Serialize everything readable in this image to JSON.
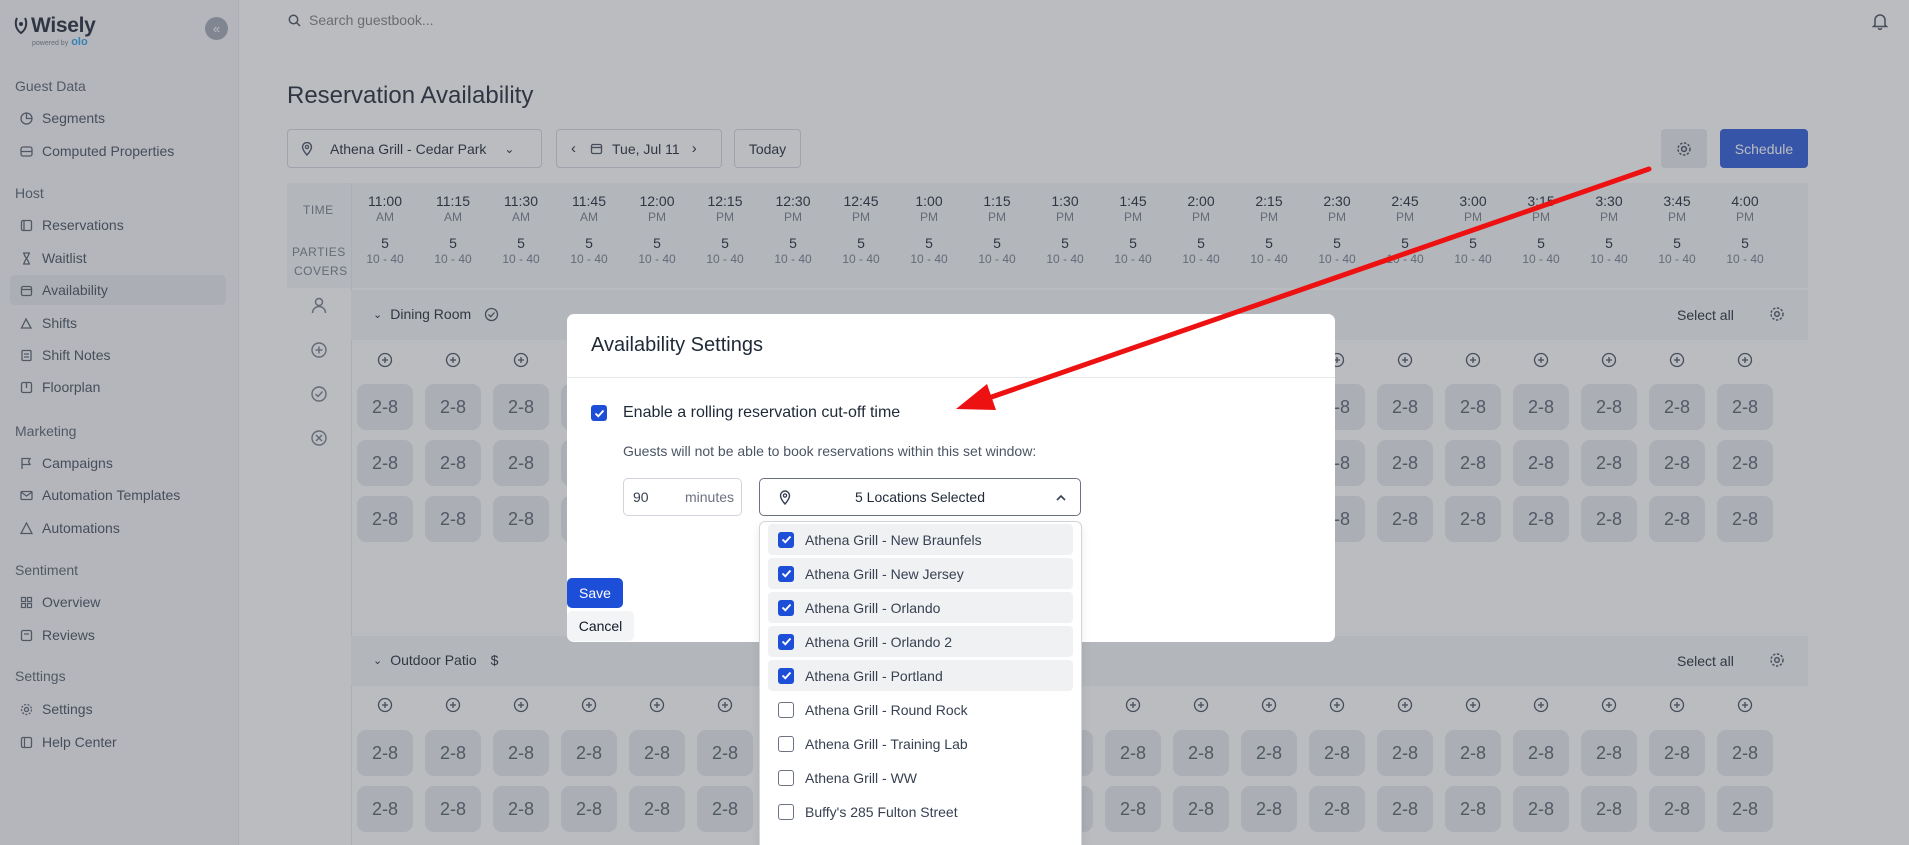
{
  "app": {
    "brand": "Wisely",
    "brand_sub": "powered by",
    "brand_partner": "olo"
  },
  "sidebar": {
    "sections": [
      {
        "title": "Guest Data",
        "items": [
          {
            "label": "Segments",
            "icon": "segments-icon"
          },
          {
            "label": "Computed Properties",
            "icon": "database-icon"
          }
        ]
      },
      {
        "title": "Host",
        "items": [
          {
            "label": "Reservations",
            "icon": "book-icon"
          },
          {
            "label": "Waitlist",
            "icon": "hourglass-icon"
          },
          {
            "label": "Availability",
            "icon": "calendar-icon"
          },
          {
            "label": "Shifts",
            "icon": "shifts-icon"
          },
          {
            "label": "Shift Notes",
            "icon": "notes-icon"
          },
          {
            "label": "Floorplan",
            "icon": "floorplan-icon"
          }
        ]
      },
      {
        "title": "Marketing",
        "items": [
          {
            "label": "Campaigns",
            "icon": "flag-icon"
          },
          {
            "label": "Automation Templates",
            "icon": "mail-icon"
          },
          {
            "label": "Automations",
            "icon": "automation-icon"
          }
        ]
      },
      {
        "title": "Sentiment",
        "items": [
          {
            "label": "Overview",
            "icon": "grid-icon"
          },
          {
            "label": "Reviews",
            "icon": "reviews-icon"
          }
        ]
      },
      {
        "title": "Settings",
        "items": [
          {
            "label": "Settings",
            "icon": "gear-icon"
          },
          {
            "label": "Help Center",
            "icon": "help-icon"
          }
        ]
      }
    ],
    "active": "Availability"
  },
  "topbar": {
    "search_placeholder": "Search guestbook..."
  },
  "page": {
    "title": "Reservation Availability",
    "location": "Athena Grill - Cedar Park",
    "date": "Tue, Jul 11",
    "today_label": "Today",
    "schedule_label": "Schedule"
  },
  "grid": {
    "time_label": "TIME",
    "parties_label": "PARTIES",
    "covers_label": "COVERS",
    "times": [
      {
        "t": "11:00",
        "ap": "AM"
      },
      {
        "t": "11:15",
        "ap": "AM"
      },
      {
        "t": "11:30",
        "ap": "AM"
      },
      {
        "t": "11:45",
        "ap": "AM"
      },
      {
        "t": "12:00",
        "ap": "PM"
      },
      {
        "t": "12:15",
        "ap": "PM"
      },
      {
        "t": "12:30",
        "ap": "PM"
      },
      {
        "t": "12:45",
        "ap": "PM"
      },
      {
        "t": "1:00",
        "ap": "PM"
      },
      {
        "t": "1:15",
        "ap": "PM"
      },
      {
        "t": "1:30",
        "ap": "PM"
      },
      {
        "t": "1:45",
        "ap": "PM"
      },
      {
        "t": "2:00",
        "ap": "PM"
      },
      {
        "t": "2:15",
        "ap": "PM"
      },
      {
        "t": "2:30",
        "ap": "PM"
      },
      {
        "t": "2:45",
        "ap": "PM"
      },
      {
        "t": "3:00",
        "ap": "PM"
      },
      {
        "t": "3:15",
        "ap": "PM"
      },
      {
        "t": "3:30",
        "ap": "PM"
      },
      {
        "t": "3:45",
        "ap": "PM"
      },
      {
        "t": "4:00",
        "ap": "PM"
      }
    ],
    "parties": "5",
    "covers": "10 - 40",
    "slot_label": "2-8",
    "rooms": [
      {
        "name": "Dining Room",
        "select_all": "Select all"
      },
      {
        "name": "Outdoor Patio",
        "select_all": "Select all"
      }
    ]
  },
  "modal": {
    "title": "Availability Settings",
    "enable_label": "Enable a rolling reservation cut-off time",
    "enabled": true,
    "help_text": "Guests will not be able to book reservations within this set window:",
    "minutes_value": "90",
    "minutes_unit": "minutes",
    "locations_summary": "5 Locations Selected",
    "save_label": "Save",
    "cancel_label": "Cancel"
  },
  "locations": [
    {
      "label": "Athena Grill - New Braunfels",
      "checked": true
    },
    {
      "label": "Athena Grill - New Jersey",
      "checked": true
    },
    {
      "label": "Athena Grill - Orlando",
      "checked": true
    },
    {
      "label": "Athena Grill - Orlando 2",
      "checked": true
    },
    {
      "label": "Athena Grill - Portland",
      "checked": true
    },
    {
      "label": "Athena Grill - Round Rock",
      "checked": false
    },
    {
      "label": "Athena Grill - Training Lab",
      "checked": false
    },
    {
      "label": "Athena Grill - WW",
      "checked": false
    },
    {
      "label": "Buffy's 285 Fulton Street",
      "checked": false
    }
  ],
  "colors": {
    "accent": "#1d4ed8",
    "annotation_arrow": "#ee1111"
  }
}
